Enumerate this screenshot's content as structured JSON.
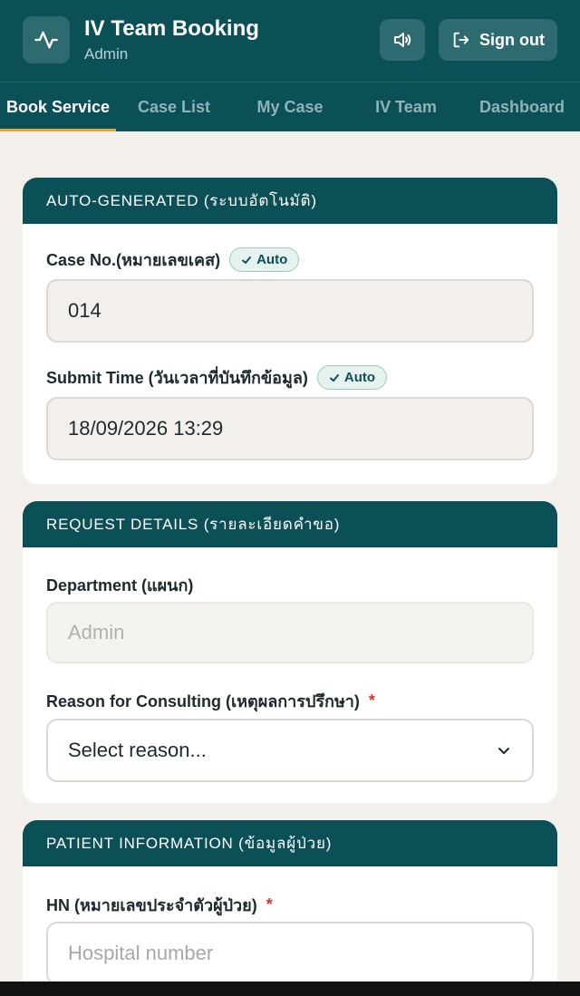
{
  "header": {
    "title": "IV Team Booking",
    "subtitle": "Admin",
    "signout_label": "Sign out",
    "icons": {
      "logo": "activity-pulse-icon",
      "sound": "speaker-volume-icon",
      "signout": "sign-out-icon"
    }
  },
  "tabs": [
    {
      "label": "Book Service",
      "active": true
    },
    {
      "label": "Case List",
      "active": false
    },
    {
      "label": "My Case",
      "active": false
    },
    {
      "label": "IV Team",
      "active": false
    },
    {
      "label": "Dashboard",
      "active": false
    }
  ],
  "auto_section": {
    "title": "AUTO-GENERATED (ระบบอัตโนมัติ)",
    "case_no_label": "Case No.(หมายเลขเคส)",
    "case_no_badge": "Auto",
    "case_no_value": "014",
    "submit_time_label": "Submit Time (วันเวลาที่บันทึกข้อมูล)",
    "submit_time_badge": "Auto",
    "submit_time_value": "18/09/2026 13:29"
  },
  "request_section": {
    "title": "REQUEST DETAILS (รายละเอียดคำขอ)",
    "department_label": "Department (แผนก)",
    "department_value": "Admin",
    "reason_label": "Reason for Consulting (เหตุผลการปรึกษา)",
    "reason_required": "*",
    "reason_value": "Select reason..."
  },
  "patient_section": {
    "title": "PATIENT INFORMATION (ข้อมูลผู้ป่วย)",
    "hn_label": "HN (หมายเลขประจำตัวผู้ป่วย)",
    "hn_required": "*",
    "hn_placeholder": "Hospital number"
  },
  "colors": {
    "primary": "#0b4f57",
    "accent": "#e7a434",
    "background": "#f3efeb",
    "required": "#d0342c"
  }
}
